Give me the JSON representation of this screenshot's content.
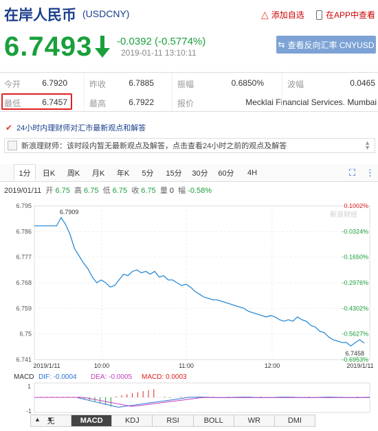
{
  "header": {
    "title": "在岸人民币",
    "code": "(USDCNY)",
    "fav_label": "添加自选",
    "app_label": "在APP中查看"
  },
  "quote": {
    "price": "6.7493",
    "change": "-0.0392 (-0.5774%)",
    "time": "2019-01-11 13:10:11",
    "reverse_label": "查看反向汇率 CNYUSD",
    "open_label": "今开",
    "open": "6.7920",
    "prev_label": "昨收",
    "prev": "6.7885",
    "amp_label": "振幅",
    "amp": "0.6850%",
    "wave_label": "波幅",
    "wave": "0.0465",
    "low_label": "最低",
    "low": "6.7457",
    "high_label": "最高",
    "high": "6.7922",
    "src_label": "报价",
    "src": "Mecklai Financial Services. Mumbai"
  },
  "news": {
    "headline": "24小时内理财师对汇市最新观点和解答",
    "item": "新浪理财师：该时段内暂无最新观点及解答，点击查看24小时之前的观点及解答"
  },
  "tabs": [
    "1分",
    "日K",
    "周K",
    "月K",
    "年K",
    "5分",
    "15分",
    "30分",
    "60分",
    "4H"
  ],
  "ohlc": {
    "date": "2019/01/11",
    "open_label": "开",
    "open": "6.75",
    "high_label": "高",
    "high": "6.75",
    "low_label": "低",
    "low": "6.75",
    "close_label": "收",
    "close": "6.75",
    "vol_label": "量",
    "vol": "0",
    "amp_label": "幅",
    "amp": "-0.58%"
  },
  "macd_header": {
    "name": "MACD",
    "dif": "DIF: -0.0004",
    "dea": "DEA: -0.0005",
    "macd": "MACD: 0.0003"
  },
  "macd_ticks": [
    "1",
    "-1"
  ],
  "indicators": [
    "无",
    "MACD",
    "KDJ",
    "RSI",
    "BOLL",
    "WR",
    "DMI"
  ],
  "watermark": "新浪财经",
  "colors": {
    "up": "#e02020",
    "down": "#1a9f3c",
    "line": "#2a8ad4",
    "brand": "#1a3e8c"
  },
  "chart_data": {
    "type": "line",
    "xlabel": "",
    "ylabel": "",
    "ylim": [
      6.741,
      6.795
    ],
    "y_ticks": [
      "6.795",
      "6.786",
      "6.777",
      "6.768",
      "6.759",
      "6.75",
      "6.741"
    ],
    "pct_ticks": [
      "0.1002%",
      "-0.0324%",
      "-0.1650%",
      "-0.2976%",
      "-0.4302%",
      "-0.5627%",
      "-0.6953%"
    ],
    "x_ticks": [
      "2019/1/11",
      "10:00",
      "11:00",
      "12:00",
      "2019/1/11"
    ],
    "annotations": {
      "high": "6.7909",
      "low": "6.7458"
    },
    "series": [
      {
        "values": [
          6.788,
          6.788,
          6.788,
          6.788,
          6.788,
          6.788,
          6.7909,
          6.7885,
          6.785,
          6.78,
          6.7775,
          6.775,
          6.773,
          6.77,
          6.768,
          6.769,
          6.768,
          6.7665,
          6.767,
          6.769,
          6.771,
          6.7705,
          6.772,
          6.7725,
          6.7715,
          6.772,
          6.771,
          6.772,
          6.77,
          6.7705,
          6.769,
          6.769,
          6.768,
          6.767,
          6.7675,
          6.7665,
          6.765,
          6.764,
          6.763,
          6.7625,
          6.762,
          6.762,
          6.7615,
          6.761,
          6.7605,
          6.76,
          6.7595,
          6.759,
          6.758,
          6.7575,
          6.757,
          6.7565,
          6.756,
          6.7565,
          6.756,
          6.755,
          6.7545,
          6.755,
          6.7545,
          6.756,
          6.755,
          6.7545,
          6.753,
          6.7525,
          6.751,
          6.7505,
          6.749,
          6.748,
          6.7475,
          6.747,
          6.747,
          6.7458,
          6.747,
          6.748,
          6.7468
        ]
      }
    ]
  }
}
